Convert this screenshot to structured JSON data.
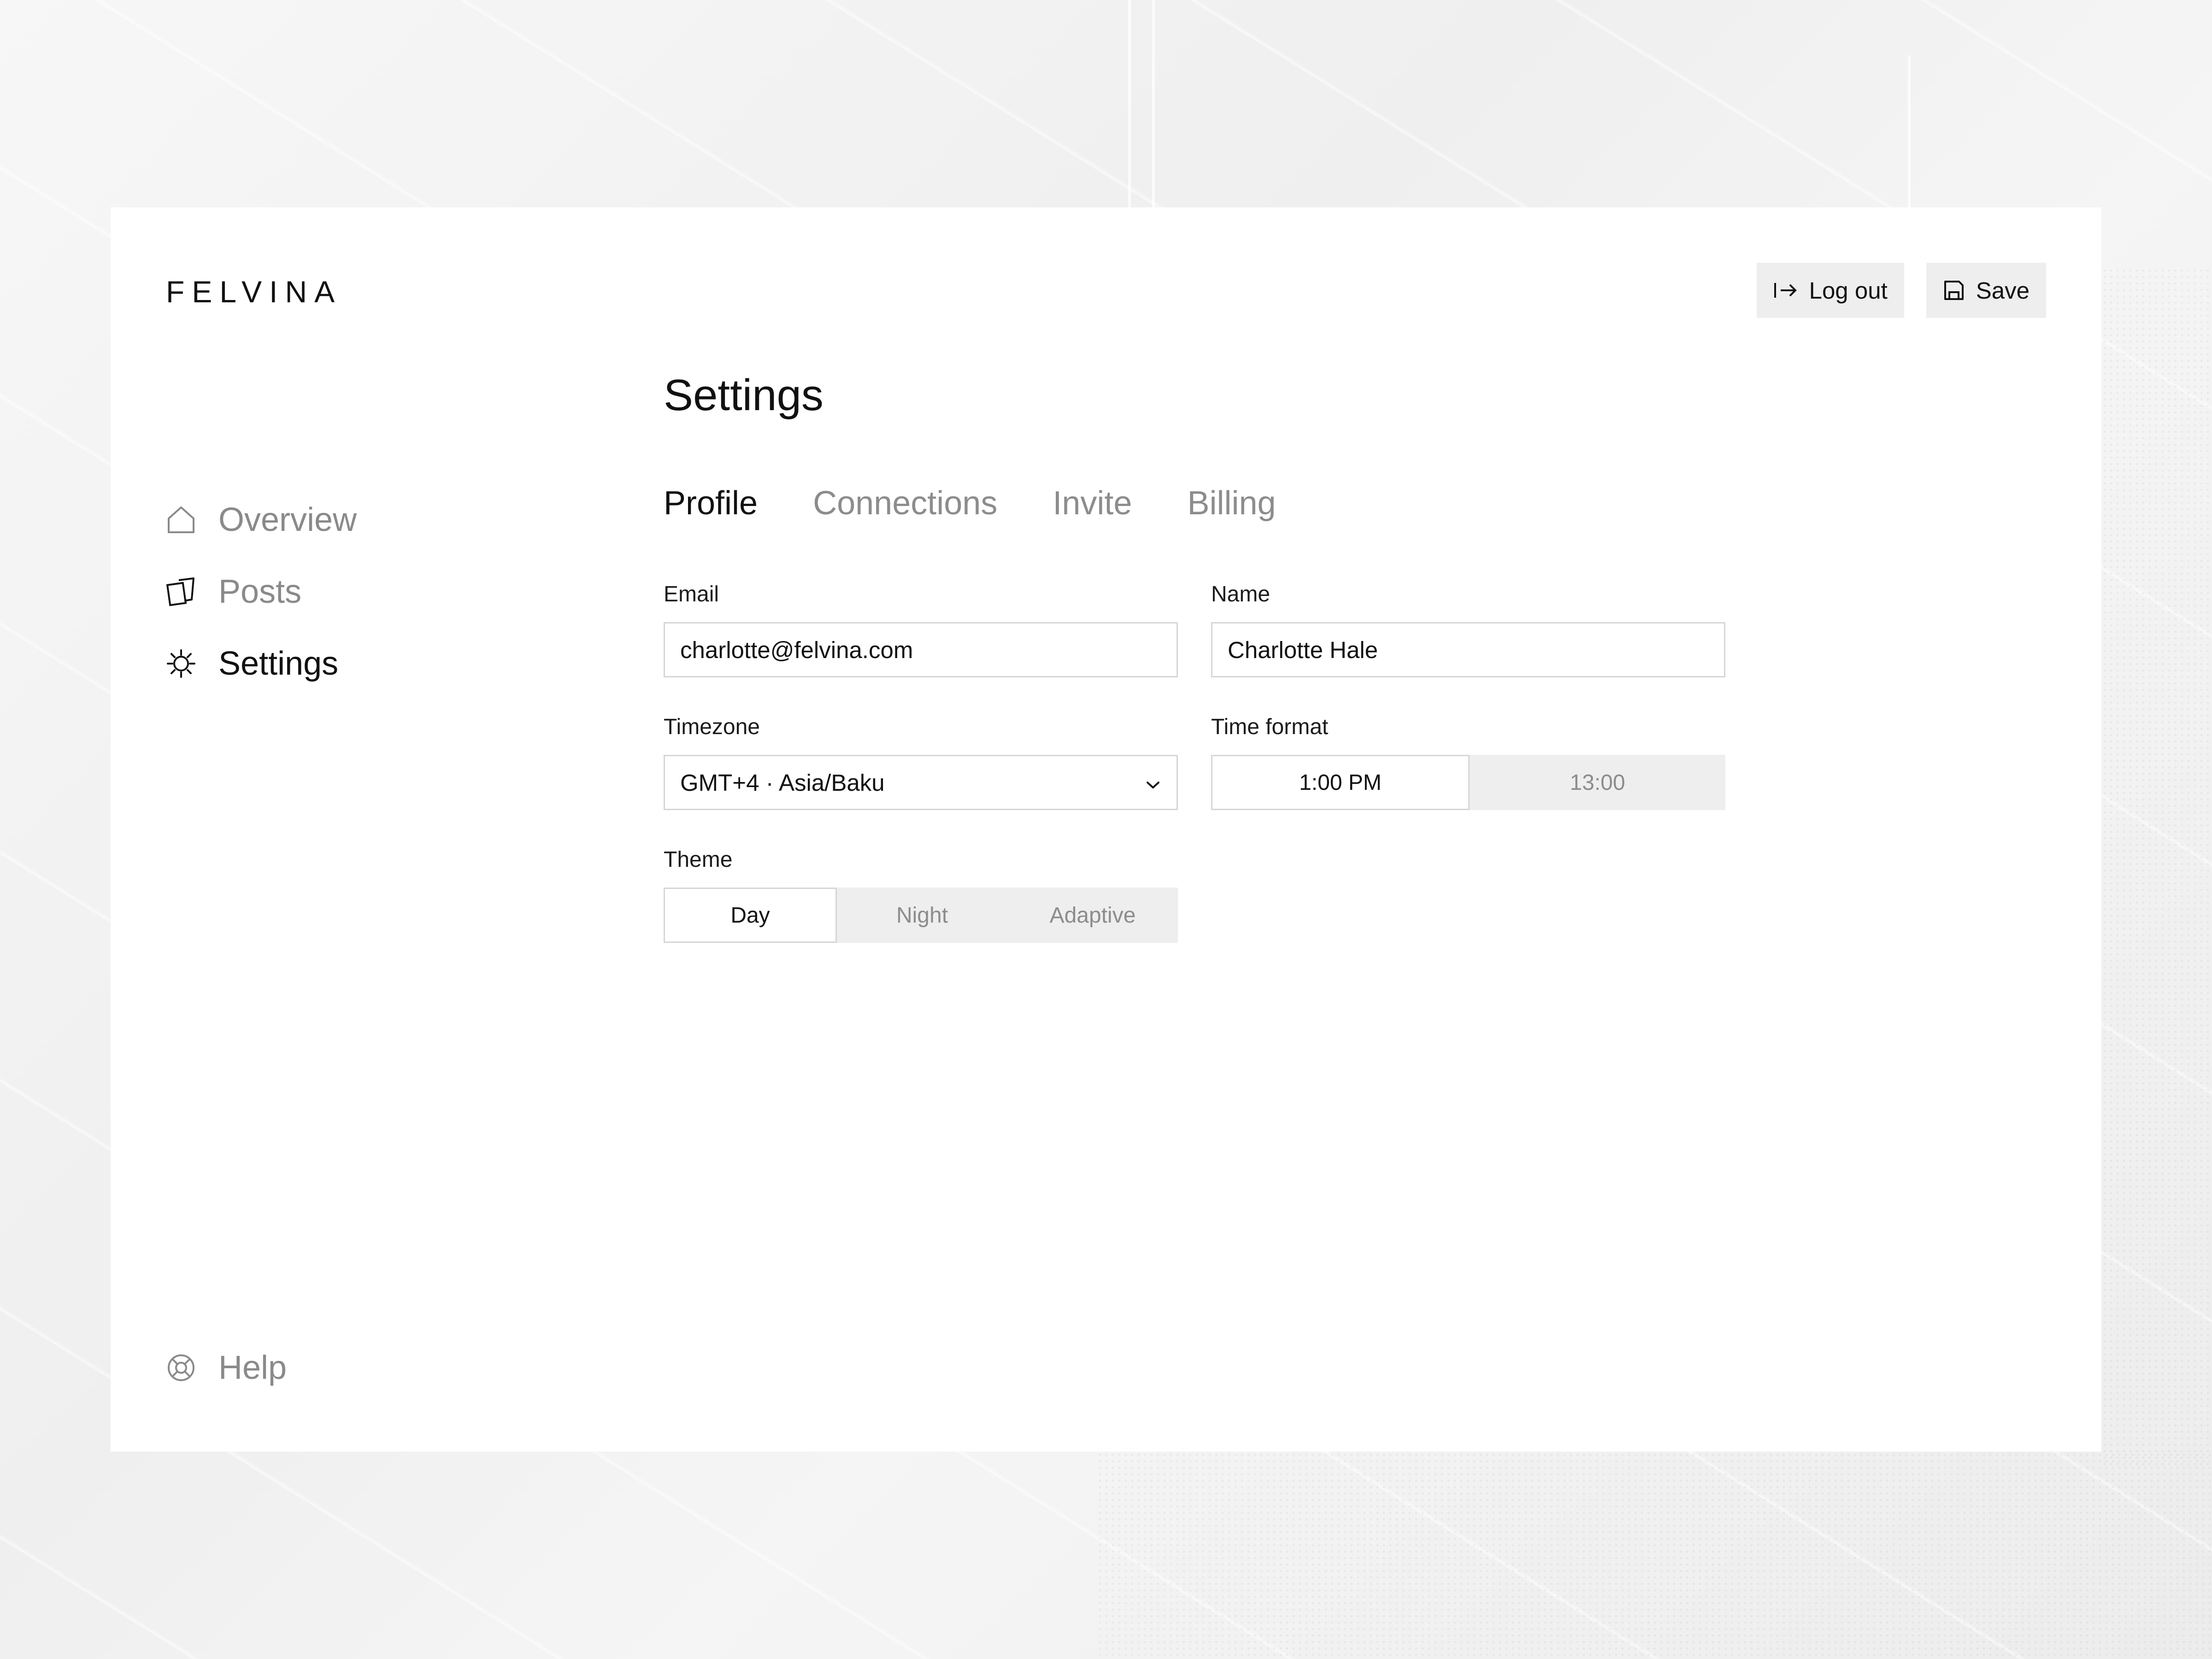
{
  "brand": "FELVINA",
  "header": {
    "logout_label": "Log out",
    "save_label": "Save"
  },
  "sidebar": {
    "items": [
      {
        "label": "Overview",
        "icon": "home-icon",
        "active": false
      },
      {
        "label": "Posts",
        "icon": "cards-icon",
        "active": false
      },
      {
        "label": "Settings",
        "icon": "gear-icon",
        "active": true
      }
    ],
    "help": {
      "label": "Help",
      "icon": "lifebuoy-icon"
    }
  },
  "main": {
    "title": "Settings",
    "tabs": [
      {
        "label": "Profile",
        "active": true
      },
      {
        "label": "Connections",
        "active": false
      },
      {
        "label": "Invite",
        "active": false
      },
      {
        "label": "Billing",
        "active": false
      }
    ]
  },
  "form": {
    "email": {
      "label": "Email",
      "value": "charlotte@felvina.com"
    },
    "name": {
      "label": "Name",
      "value": "Charlotte Hale"
    },
    "timezone": {
      "label": "Timezone",
      "value": "GMT+4 · Asia/Baku"
    },
    "time_format": {
      "label": "Time format",
      "options": [
        "1:00 PM",
        "13:00"
      ],
      "selected": "1:00 PM"
    },
    "theme": {
      "label": "Theme",
      "options": [
        "Day",
        "Night",
        "Adaptive"
      ],
      "selected": "Day"
    }
  }
}
